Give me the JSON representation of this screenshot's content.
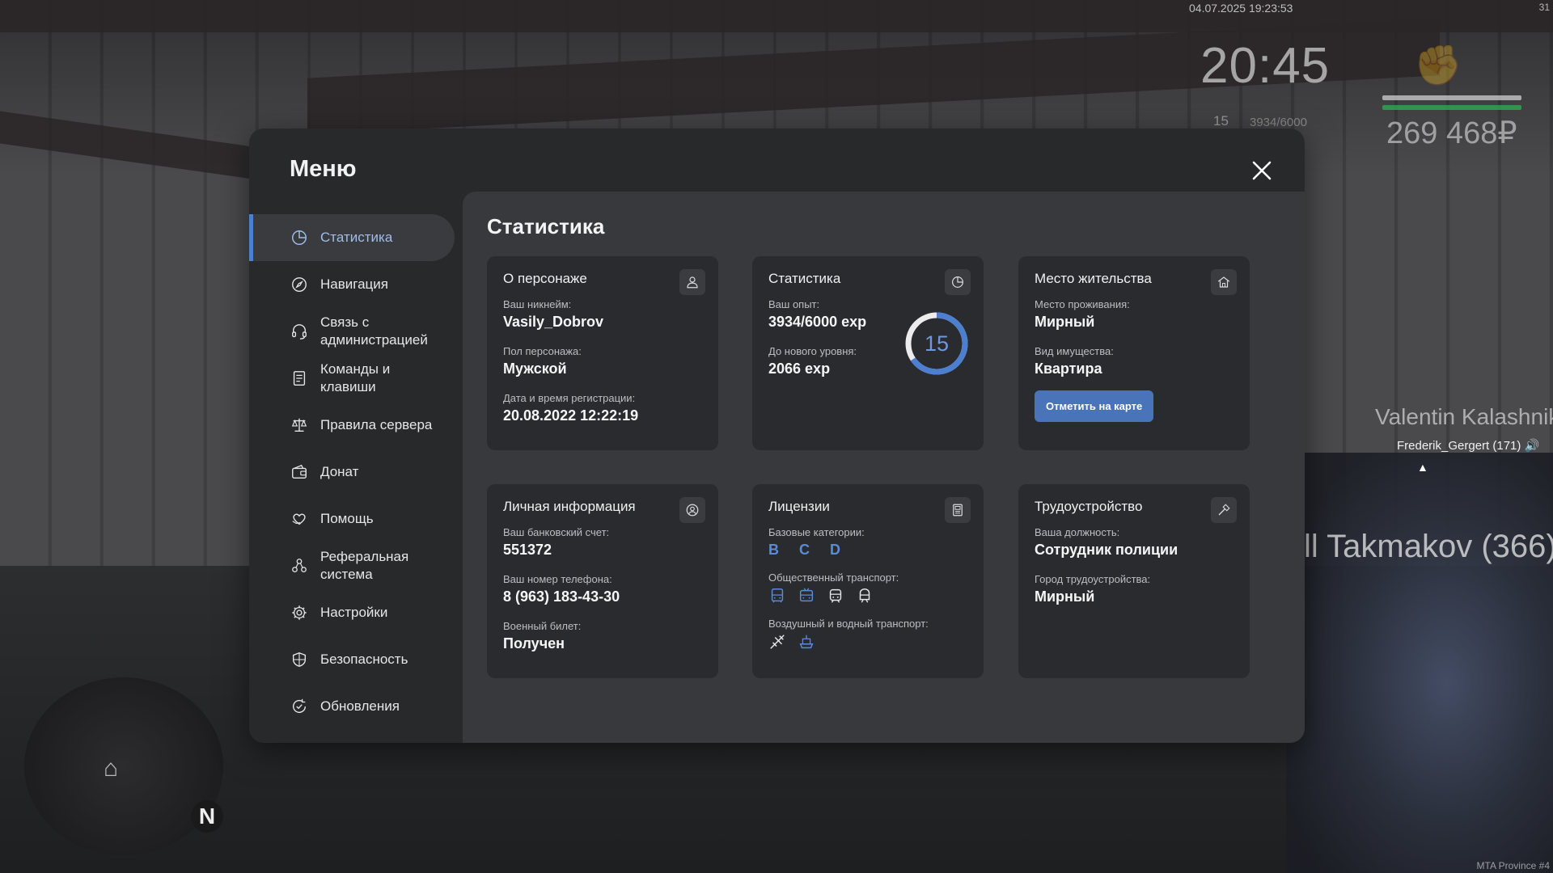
{
  "hud": {
    "datetime": "04.07.2025 19:23:53",
    "corner": "31",
    "time": "20:45",
    "level": "15",
    "exp": "3934/6000",
    "money": "269 468₽",
    "bars_colors": [
      "#2fa84f",
      "#d8d8d8"
    ],
    "nametag_a": "Valentin Kalashnikov",
    "nametag_b": "Frederik_Gergert (171) 🔊",
    "nametag_c": "ll Takmakov (366)",
    "minimap_north": "N",
    "watermark": "MTA Province #4"
  },
  "menu": {
    "title": "Меню",
    "sidebar": [
      {
        "label": "Статистика",
        "icon": "chart-pie-icon",
        "active": true
      },
      {
        "label": "Навигация",
        "icon": "compass-icon"
      },
      {
        "label": "Связь с администрацией",
        "icon": "headset-icon"
      },
      {
        "label": "Команды и клавиши",
        "icon": "document-list-icon"
      },
      {
        "label": "Правила сервера",
        "icon": "scales-icon"
      },
      {
        "label": "Донат",
        "icon": "wallet-icon"
      },
      {
        "label": "Помощь",
        "icon": "heart-hand-icon"
      },
      {
        "label": "Реферальная система",
        "icon": "people-network-icon"
      },
      {
        "label": "Настройки",
        "icon": "gear-icon"
      },
      {
        "label": "Безопасность",
        "icon": "shield-icon"
      },
      {
        "label": "Обновления",
        "icon": "refresh-check-icon"
      }
    ],
    "content_title": "Статистика",
    "accent": "#4d7fd0",
    "cards": {
      "character": {
        "title": "О персонаже",
        "nick_label": "Ваш никнейм:",
        "nick": "Vasily_Dobrov",
        "gender_label": "Пол персонажа:",
        "gender": "Мужской",
        "reg_label": "Дата и время регистрации:",
        "reg": "20.08.2022 12:22:19"
      },
      "stats": {
        "title": "Статистика",
        "exp_label": "Ваш опыт:",
        "exp": "3934/6000 exp",
        "next_label": "До нового уровня:",
        "next": "2066 exp",
        "level": "15",
        "progress": 0.656
      },
      "residence": {
        "title": "Место жительства",
        "place_label": "Место проживания:",
        "place": "Мирный",
        "type_label": "Вид имущества:",
        "type": "Квартира",
        "map_button": "Отметить на карте"
      },
      "personal": {
        "title": "Личная информация",
        "bank_label": "Ваш банковский счет:",
        "bank": "551372",
        "phone_label": "Ваш номер телефона:",
        "phone": "8 (963) 183-43-30",
        "military_label": "Военный билет:",
        "military": "Получен"
      },
      "licenses": {
        "title": "Лицензии",
        "base_label": "Базовые категории:",
        "base": "B C D",
        "public_label": "Общественный транспорт:",
        "air_label": "Воздушный и водный транспорт:"
      },
      "job": {
        "title": "Трудоустройство",
        "position_label": "Ваша должность:",
        "position": "Сотрудник полиции",
        "city_label": "Город трудоустройства:",
        "city": "Мирный"
      }
    }
  }
}
